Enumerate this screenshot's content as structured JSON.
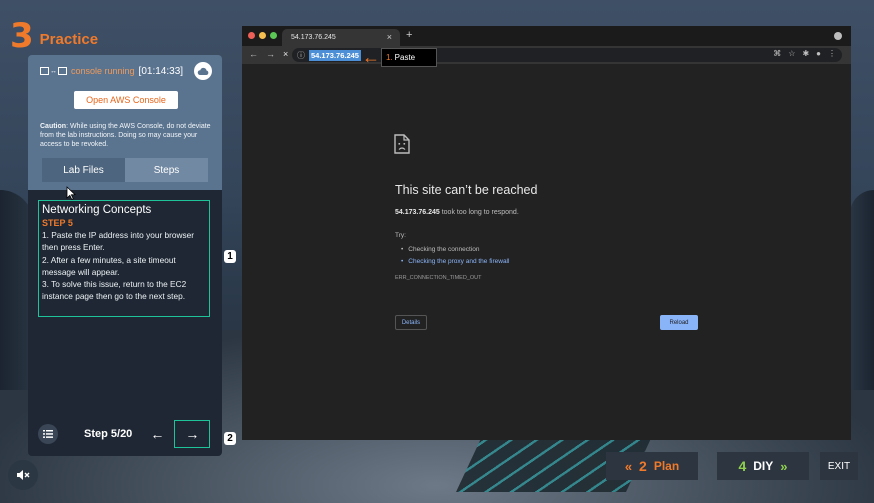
{
  "practice": {
    "step_number": "3",
    "title": "Practice"
  },
  "console_panel": {
    "status_text": "console running",
    "timer": "[01:14:33]",
    "open_console_label": "Open AWS Console",
    "caution_label": "Caution",
    "caution_text": ": While using the AWS Console, do not deviate from the lab instructions. Doing so may cause your access to be revoked."
  },
  "tabs": [
    {
      "label": "Lab Files",
      "active": false
    },
    {
      "label": "Steps",
      "active": true
    }
  ],
  "step": {
    "heading": "Networking Concepts",
    "label": "STEP 5",
    "lines": [
      "1.  Paste the IP address into your browser then press Enter.",
      "2.  After a few minutes, a site timeout message will appear.",
      "3.  To solve this issue, return to the EC2 instance page then go to the next step."
    ]
  },
  "navigation": {
    "counter": "Step 5/20",
    "prev_icon": "arrow-left-icon",
    "next_icon": "arrow-right-icon"
  },
  "badges": {
    "steps_box": "1",
    "next_button": "2"
  },
  "browser": {
    "tab_title": "54.173.76.245",
    "url": "54.173.76.245",
    "callout": {
      "number": "1.",
      "text": "Paste"
    },
    "error": {
      "title": "This site can’t be reached",
      "host": "54.173.76.245",
      "message": " took too long to respond.",
      "try_label": "Try:",
      "suggestions": [
        {
          "text": "Checking the connection",
          "link": false
        },
        {
          "text": "Checking the proxy and the firewall",
          "link": true
        }
      ],
      "code": "ERR_CONNECTION_TIMED_OUT",
      "details_label": "Details",
      "reload_label": "Reload"
    }
  },
  "footer": {
    "plan": {
      "number": "2",
      "label": "Plan"
    },
    "diy": {
      "number": "4",
      "label": "DIY"
    },
    "exit_label": "EXIT"
  },
  "colors": {
    "accent_orange": "#f07a2b",
    "accent_teal": "#1ec39a",
    "accent_green": "#8fd14f",
    "link_blue": "#8ab4f8"
  }
}
